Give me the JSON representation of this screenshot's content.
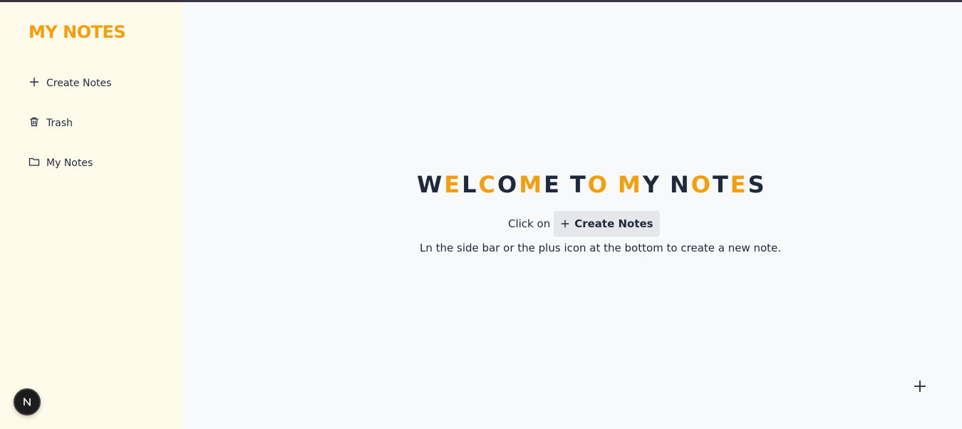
{
  "sidebar": {
    "brand": "MY NOTES",
    "items": [
      {
        "label": "Create Notes",
        "icon": "plus-icon"
      },
      {
        "label": "Trash",
        "icon": "trash-icon"
      },
      {
        "label": "My Notes",
        "icon": "folder-icon"
      }
    ]
  },
  "main": {
    "welcome_letters": [
      {
        "ch": "W",
        "accent": false
      },
      {
        "ch": "E",
        "accent": true
      },
      {
        "ch": "L",
        "accent": false
      },
      {
        "ch": "C",
        "accent": true
      },
      {
        "ch": "O",
        "accent": false
      },
      {
        "ch": "M",
        "accent": true
      },
      {
        "ch": "E",
        "accent": false
      },
      {
        "ch": " ",
        "accent": false
      },
      {
        "ch": "T",
        "accent": false
      },
      {
        "ch": "O",
        "accent": true
      },
      {
        "ch": " ",
        "accent": false
      },
      {
        "ch": "M",
        "accent": true
      },
      {
        "ch": "Y",
        "accent": false
      },
      {
        "ch": " ",
        "accent": false
      },
      {
        "ch": "N",
        "accent": false
      },
      {
        "ch": "O",
        "accent": true
      },
      {
        "ch": "T",
        "accent": false
      },
      {
        "ch": "E",
        "accent": true
      },
      {
        "ch": "S",
        "accent": false
      }
    ],
    "click_prefix": "Click on",
    "create_chip_label": "Create Notes",
    "subtext": "Ln the side bar or the plus icon at the bottom to create a new note."
  },
  "floating": {
    "avatar_letter": "N"
  },
  "colors": {
    "accent": "#f59e0b",
    "text": "#1e293b",
    "sidebar_bg": "#fffbeb",
    "main_bg": "#f8f9fb"
  }
}
